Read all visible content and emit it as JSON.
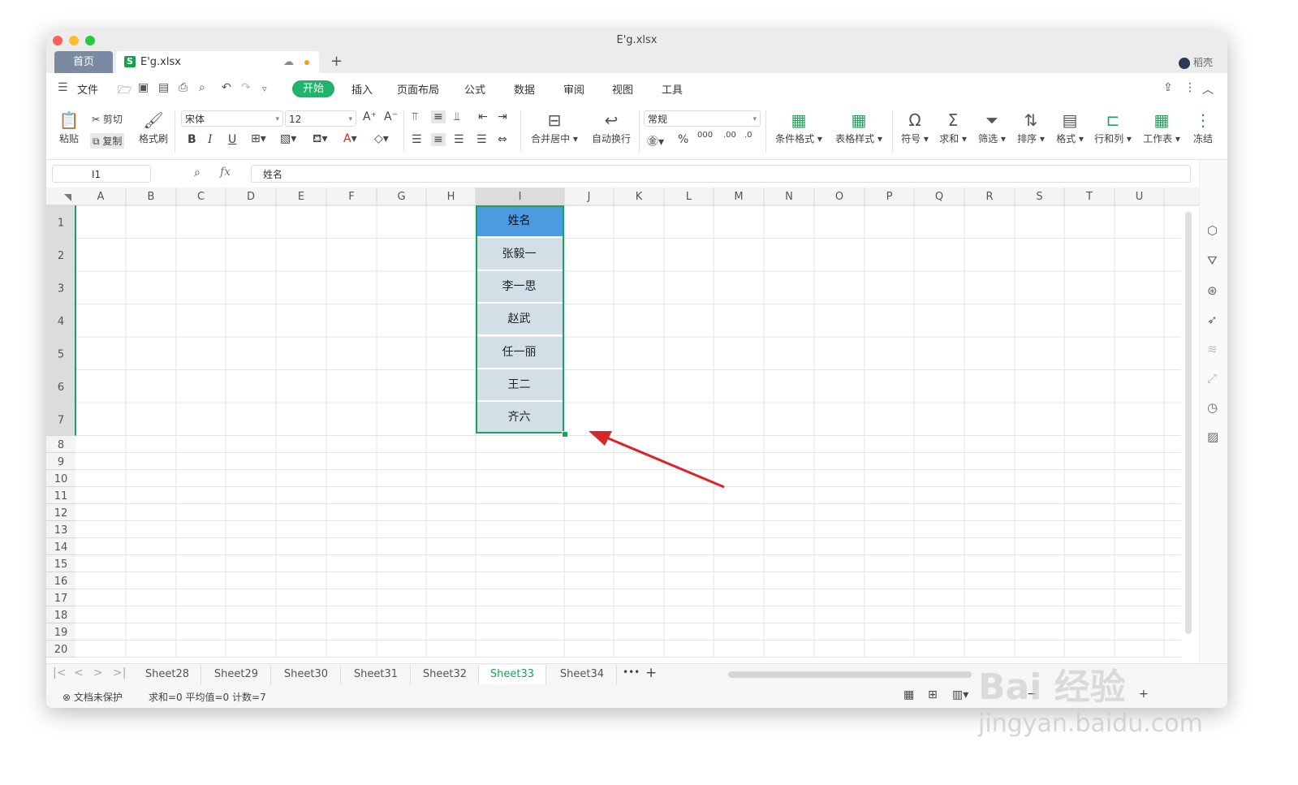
{
  "window": {
    "title": "E'g.xlsx",
    "traffic_colors": [
      "#fe5f57",
      "#febc2e",
      "#28c840"
    ]
  },
  "tabs": {
    "home": "首页",
    "file": "E'g.xlsx",
    "file_badge": "S",
    "add": "+"
  },
  "user": {
    "name": "稻壳"
  },
  "menu": {
    "file": "文件",
    "items": [
      "开始",
      "插入",
      "页面布局",
      "公式",
      "数据",
      "审阅",
      "视图",
      "工具"
    ]
  },
  "ribbon": {
    "paste": "粘贴",
    "cut": "剪切",
    "copy": "复制",
    "format_painter": "格式刷",
    "font": "宋体",
    "font_size": "12",
    "merge_center": "合并居中",
    "wrap_text": "自动换行",
    "number_format": "常规",
    "conditional_format": "条件格式",
    "table_style": "表格样式",
    "symbol": "符号",
    "sum": "求和",
    "filter": "筛选",
    "sort": "排序",
    "format": "格式",
    "row_col": "行和列",
    "worksheet": "工作表",
    "freeze": "冻结"
  },
  "formula_bar": {
    "cell_ref": "I1",
    "fx": "fx",
    "value": "姓名"
  },
  "grid": {
    "columns": [
      "A",
      "B",
      "C",
      "D",
      "E",
      "F",
      "G",
      "H",
      "I",
      "J",
      "K",
      "L",
      "M",
      "N",
      "O",
      "P",
      "Q",
      "R",
      "S",
      "T",
      "U"
    ],
    "rows": [
      "1",
      "2",
      "3",
      "4",
      "5",
      "6",
      "7",
      "8",
      "9",
      "10",
      "11",
      "12",
      "13",
      "14",
      "15",
      "16",
      "17",
      "18",
      "19",
      "20"
    ],
    "selected_column": "I",
    "cells": [
      "姓名",
      "张毅一",
      "李一思",
      "赵武",
      "任一丽",
      "王二",
      "齐六"
    ]
  },
  "sheet_tabs": {
    "tabs": [
      "Sheet28",
      "Sheet29",
      "Sheet30",
      "Sheet31",
      "Sheet32",
      "Sheet33",
      "Sheet34"
    ],
    "active": "Sheet33",
    "more": "•••",
    "add": "+"
  },
  "status": {
    "protect": "文档未保护",
    "stats": "求和=0  平均值=0  计数=7"
  },
  "watermark": {
    "brand": "Bai 经验",
    "url": "jingyan.baidu.com"
  },
  "colors": {
    "accent": "#20b36b",
    "selected_fill": "#d3dfe6",
    "header_fill": "#4c9be0",
    "arrow": "#d8262c"
  }
}
